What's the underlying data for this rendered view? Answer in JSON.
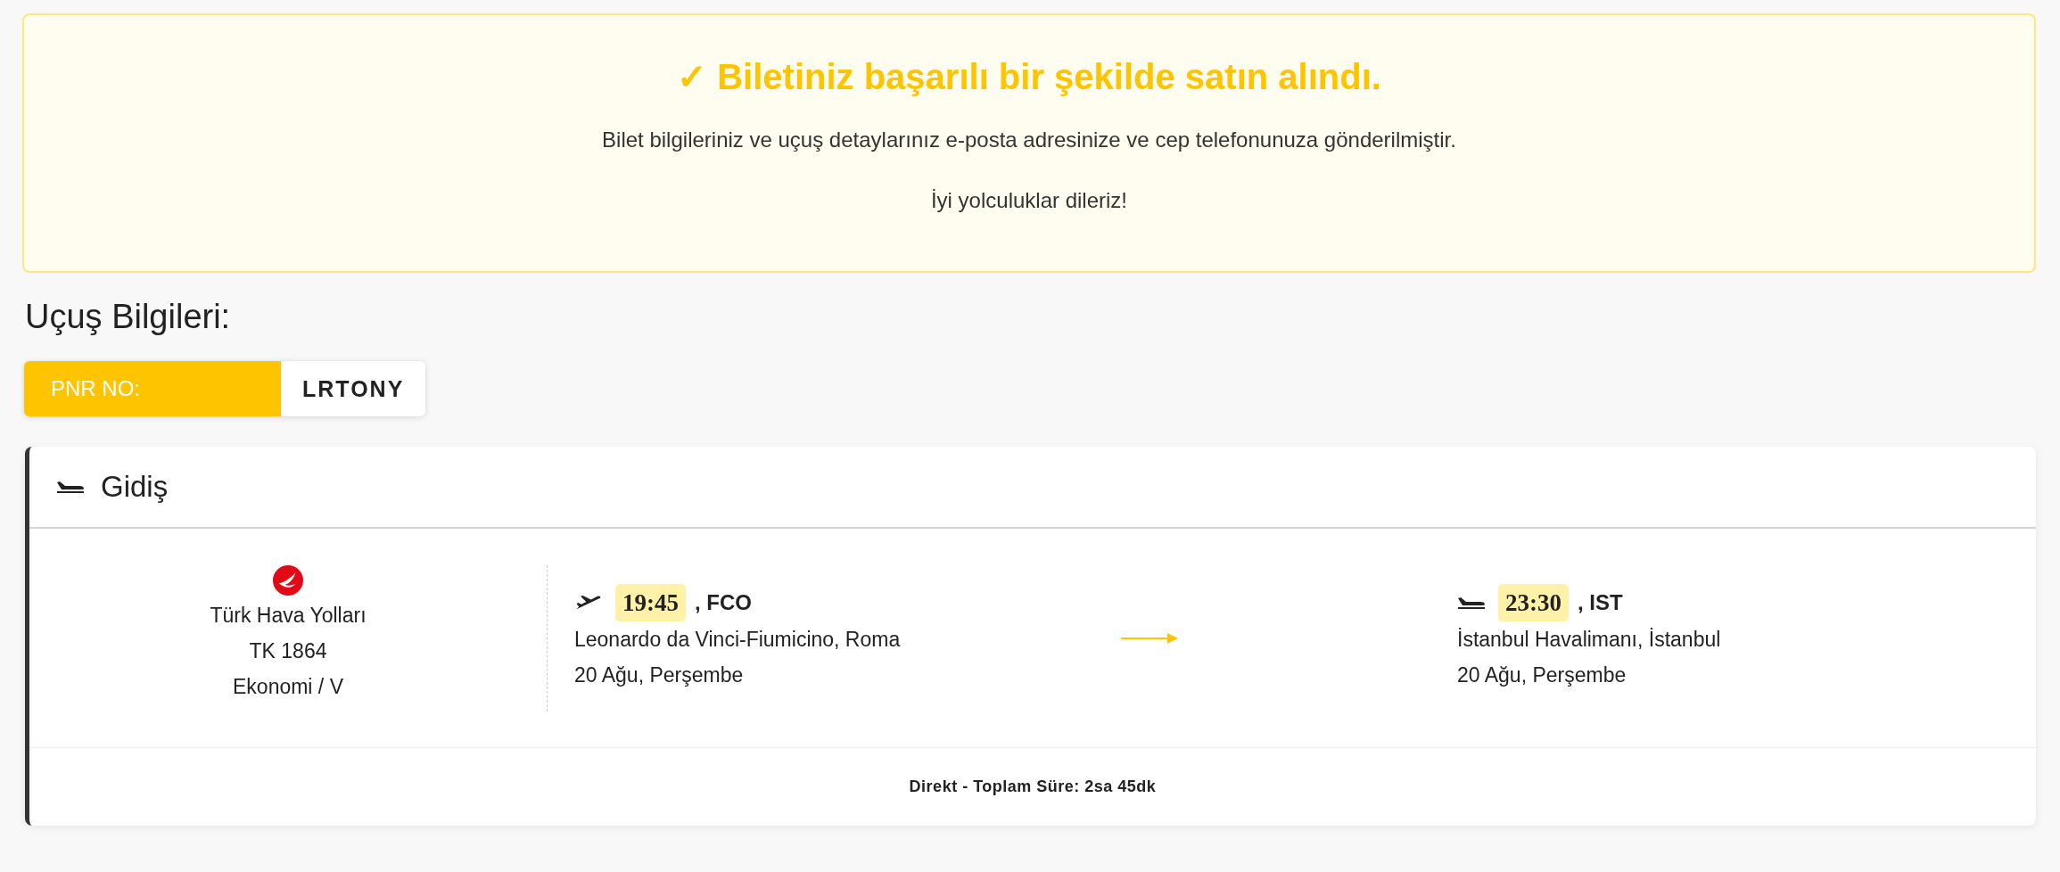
{
  "success": {
    "check": "✓",
    "title": "Biletiniz başarılı bir şekilde satın alındı.",
    "message": "Bilet bilgileriniz ve uçuş detaylarınız e-posta adresinize ve cep telefonunuza gönderilmiştir.",
    "wish": "İyi yolculuklar dileriz!"
  },
  "section_title": "Uçuş Bilgileri:",
  "pnr": {
    "label": "PNR NO:",
    "value": "LRTONY"
  },
  "flight": {
    "title": "Gidiş",
    "airline": {
      "name": "Türk Hava Yolları",
      "flight_no": "TK 1864",
      "cabin": "Ekonomi / V"
    },
    "departure": {
      "time": "19:45",
      "code": ", FCO",
      "airport": "Leonardo da Vinci-Fiumicino, Roma",
      "date": "20 Ağu, Perşembe"
    },
    "arrival": {
      "time": "23:30",
      "code": ", IST",
      "airport": "İstanbul Havalimanı, İstanbul",
      "date": "20 Ağu, Perşembe"
    },
    "summary": "Direkt - Toplam Süre: 2sa 45dk"
  }
}
